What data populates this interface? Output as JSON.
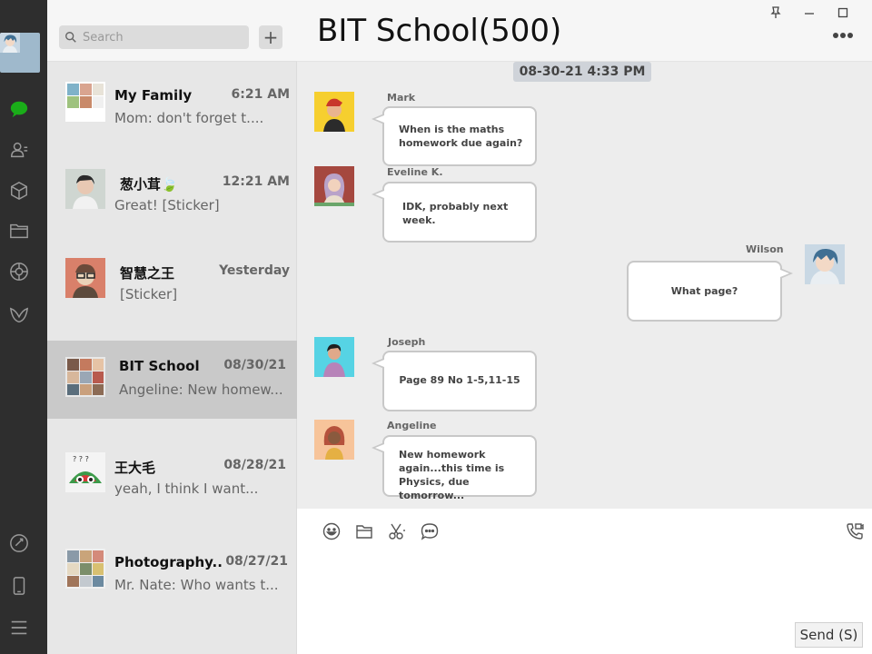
{
  "colors": {
    "rail_bg": "#2e2e2e",
    "accent_green": "#1aad19",
    "list_bg": "#e7e7e7",
    "active_item_bg": "#c9c9c9",
    "timestamp_bg": "#cfd3d9"
  },
  "sidebar": {
    "icons": [
      "avatar",
      "chat-icon",
      "contacts-icon",
      "cube-icon",
      "folder-icon",
      "moments-icon",
      "mini-programs-icon",
      "link-icon",
      "phone-icon",
      "menu-icon"
    ]
  },
  "search": {
    "placeholder": "Search",
    "add_label": "+"
  },
  "chats": [
    {
      "name": "My Family",
      "time": "6:21 AM",
      "preview": "Mom: don't forget t...."
    },
    {
      "name": "葱小茸🍃",
      "time": "12:21 AM",
      "preview": "Great! [Sticker]"
    },
    {
      "name": "智慧之王",
      "time": "Yesterday",
      "preview": "[Sticker]"
    },
    {
      "name": "BIT School",
      "time": "08/30/21",
      "preview": "Angeline: New homew..."
    },
    {
      "name": "王大毛",
      "time": "08/28/21",
      "preview": "yeah, I think I want..."
    },
    {
      "name": "Photography...",
      "time": "08/27/21",
      "preview": "Mr. Nate: Who wants t..."
    }
  ],
  "conversation": {
    "title": "BIT School(500)",
    "timestamp": "08-30-21 4:33 PM",
    "messages": [
      {
        "sender": "Mark",
        "text": "When is the maths homework due again?",
        "side": "left"
      },
      {
        "sender": "Eveline K.",
        "text": "IDK, probably next week.",
        "side": "left"
      },
      {
        "sender": "Wilson",
        "text": "What page?",
        "side": "right"
      },
      {
        "sender": "Joseph",
        "text": "Page 89 No 1-5,11-15",
        "side": "left"
      },
      {
        "sender": "Angeline",
        "text": "New homework again...this time is Physics, due tomorrow...",
        "side": "left"
      }
    ]
  },
  "composer": {
    "tools": [
      "emoji-icon",
      "folder-icon",
      "scissors-icon",
      "chat-bubble-icon"
    ],
    "call_icon": "video-call-icon",
    "send_label": "Send (S)"
  }
}
